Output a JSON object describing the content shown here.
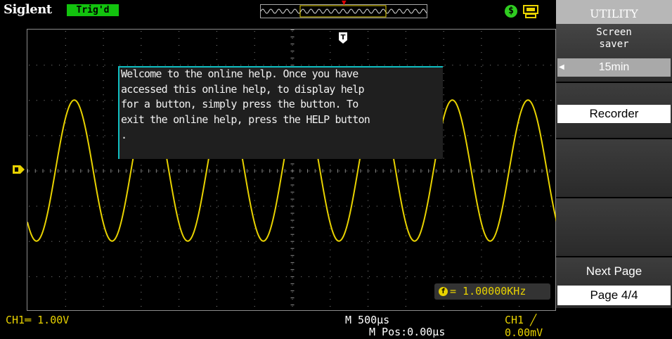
{
  "brand": "Siglent",
  "trigger_status": "Trig'd",
  "help_text": "Welcome to the online help. Once you have\naccessed this online help, to display help\nfor a button, simply press the button. To\nexit the online help, press the HELP button\n.",
  "frequency": "= 1.00000KHz",
  "bottom": {
    "ch1_scale": "CH1═ 1.00V",
    "time_scale": "M 500µs",
    "m_pos": "M Pos:0.00µs",
    "trigger_level": "CH1 ╱ 0.00mV"
  },
  "menu": {
    "title": "UTILITY",
    "screen_saver_label": "Screen\nsaver",
    "screen_saver_value": "15min",
    "recorder": "Recorder",
    "next_page_label": "Next Page",
    "page_value": "Page 4/4"
  },
  "colors": {
    "trace": "#e8d200",
    "trig_badge": "#12c30e",
    "help_accent": "#10bfc2",
    "grid": "#8c8c8c"
  },
  "icons": {
    "usb": "usb-icon",
    "printer": "printer-icon",
    "trigger_time_marker": "t-marker-icon",
    "channel_marker": "ch1-level-marker-icon",
    "frequency_counter": "frequency-icon"
  },
  "chart_data": {
    "type": "line",
    "series": [
      {
        "name": "CH1",
        "shape": "sine"
      }
    ],
    "frequency_khz": 1.0,
    "time_per_div_us": 500,
    "divisions_x": 14,
    "divisions_y": 8,
    "grid": true
  }
}
